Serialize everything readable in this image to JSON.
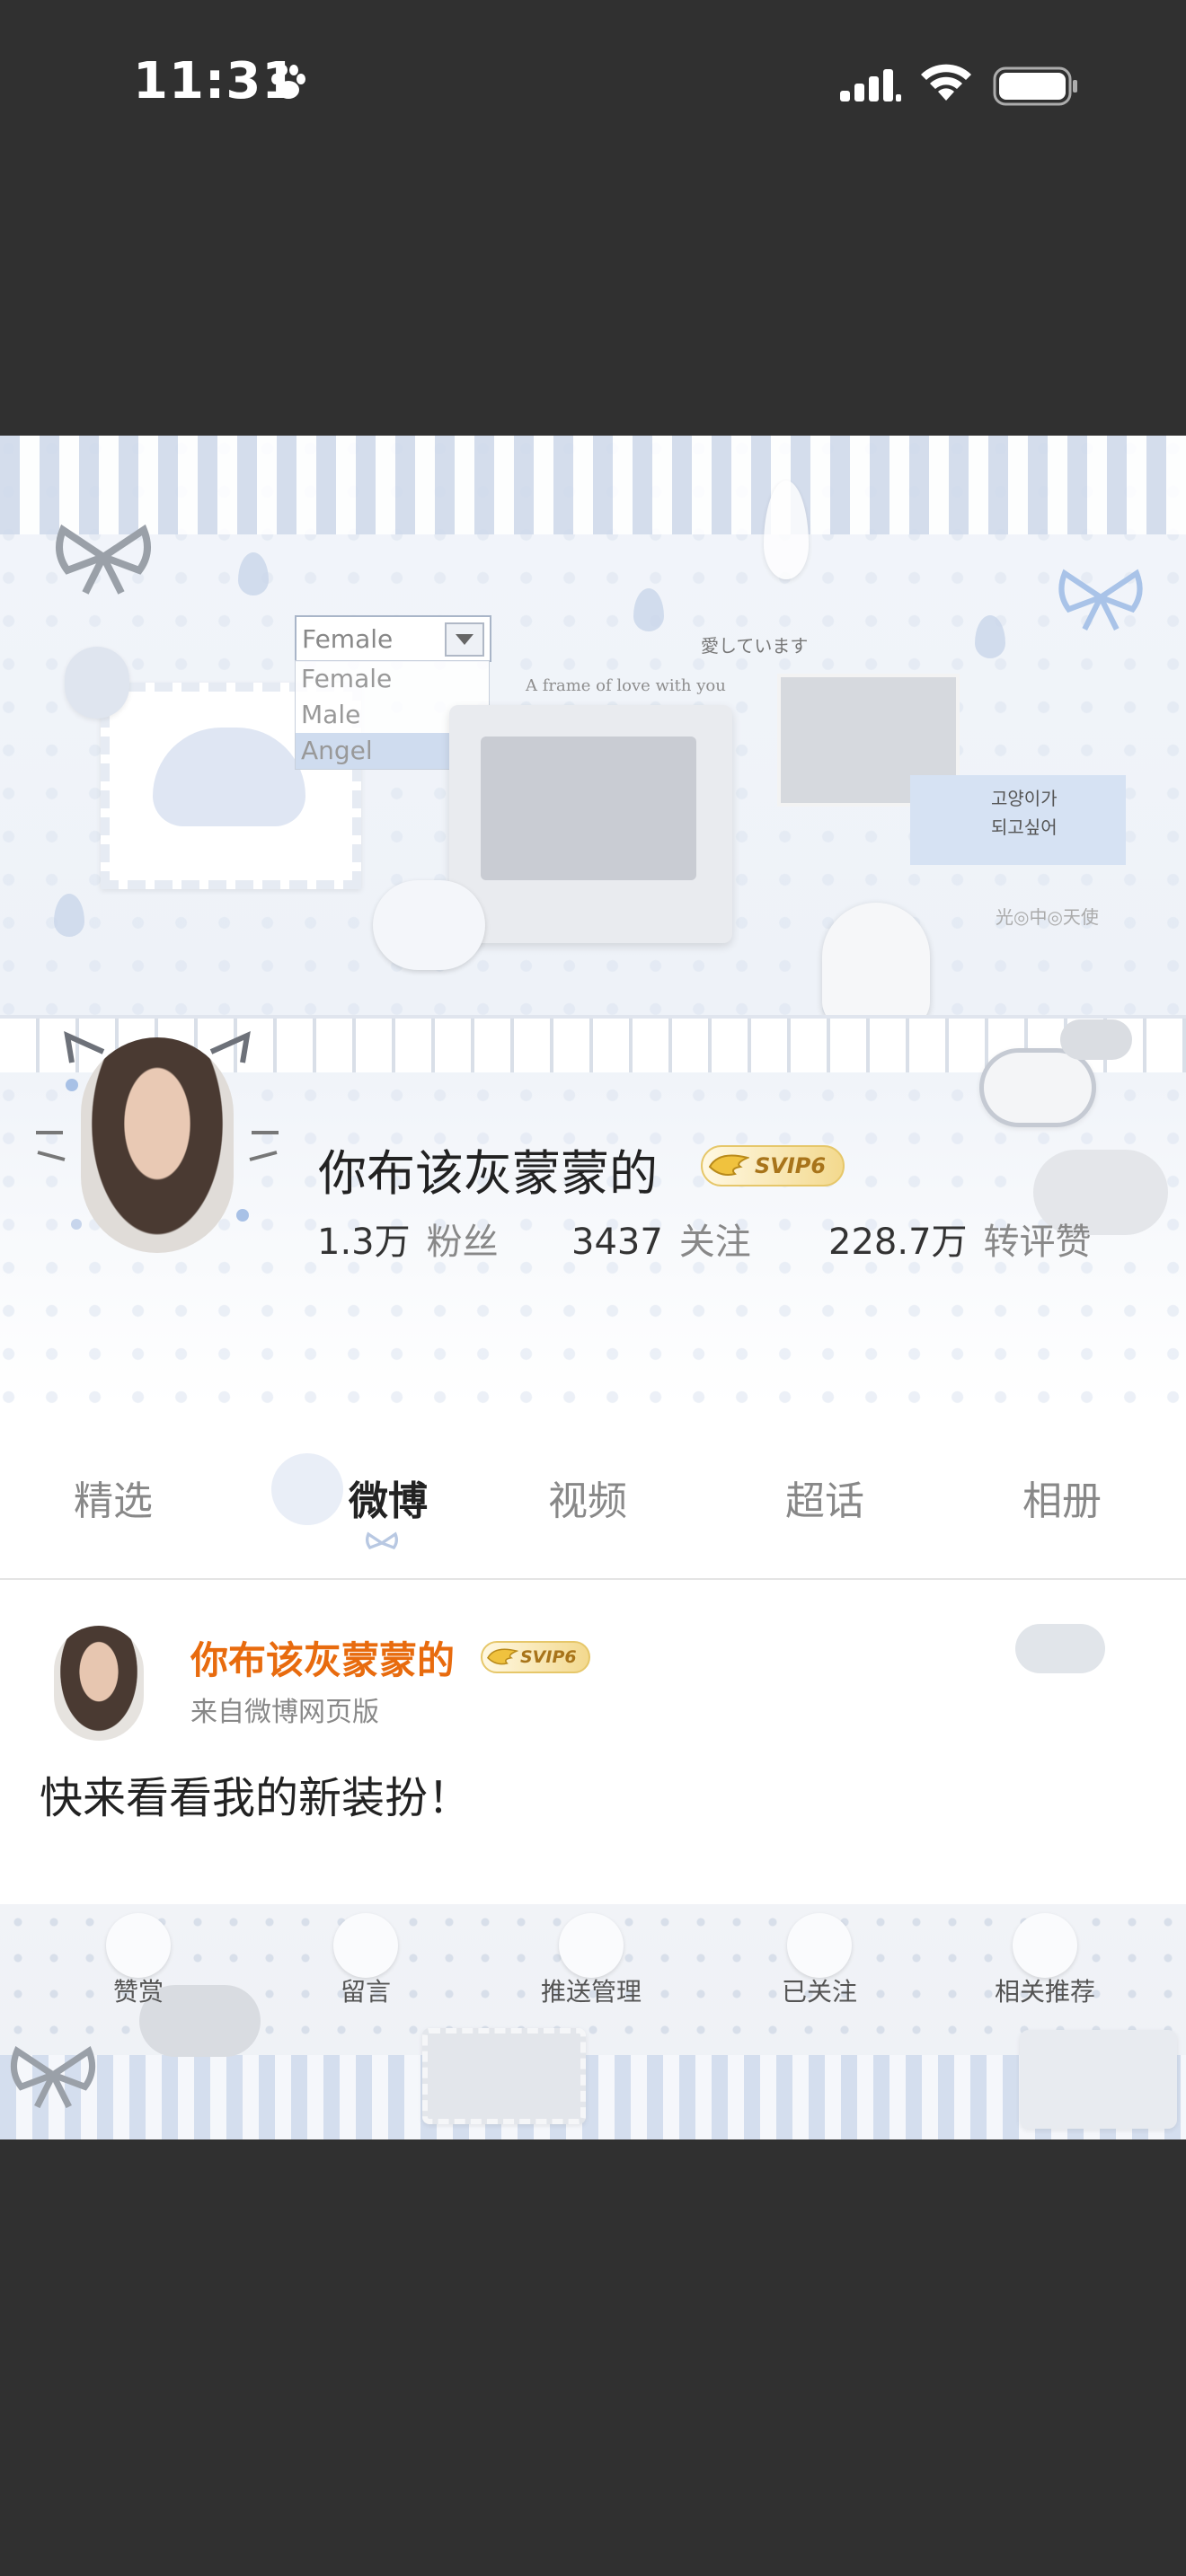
{
  "status_bar": {
    "time": "11:31"
  },
  "header_deco": {
    "gender_select": {
      "value": "Female",
      "options": [
        "Female",
        "Male",
        "Angel"
      ],
      "selected": "Angel"
    },
    "frame_caption": "A frame of love with you",
    "jp_text": "愛しています",
    "korean_text_1": "고양이가",
    "korean_text_2": "되고싶어",
    "angel_text": "光◎中◎天使"
  },
  "profile": {
    "name": "你布该灰蒙蒙的",
    "badge": "SVIP6",
    "followers_count": "1.3万",
    "followers_label": "粉丝",
    "following_count": "3437",
    "following_label": "关注",
    "likes_count": "228.7万",
    "likes_label": "转评赞"
  },
  "tabs": [
    {
      "label": "精选"
    },
    {
      "label": "微博",
      "active": true
    },
    {
      "label": "视频"
    },
    {
      "label": "超话"
    },
    {
      "label": "相册"
    }
  ],
  "post": {
    "author": "你布该灰蒙蒙的",
    "badge": "SVIP6",
    "source": "来自微博网页版",
    "text": "快来看看我的新装扮！"
  },
  "actions": [
    {
      "label": "赞赏",
      "icon": "cat-face-icon"
    },
    {
      "label": "留言",
      "icon": "flower-icon"
    },
    {
      "label": "推送管理",
      "icon": "cloud-icon"
    },
    {
      "label": "已关注",
      "icon": "umbrella-icon"
    },
    {
      "label": "相关推荐",
      "icon": "paw-icon"
    }
  ],
  "colors": {
    "accent_orange": "#e86b0e",
    "svip_gold": "#e6c76a",
    "background": "#303030"
  }
}
